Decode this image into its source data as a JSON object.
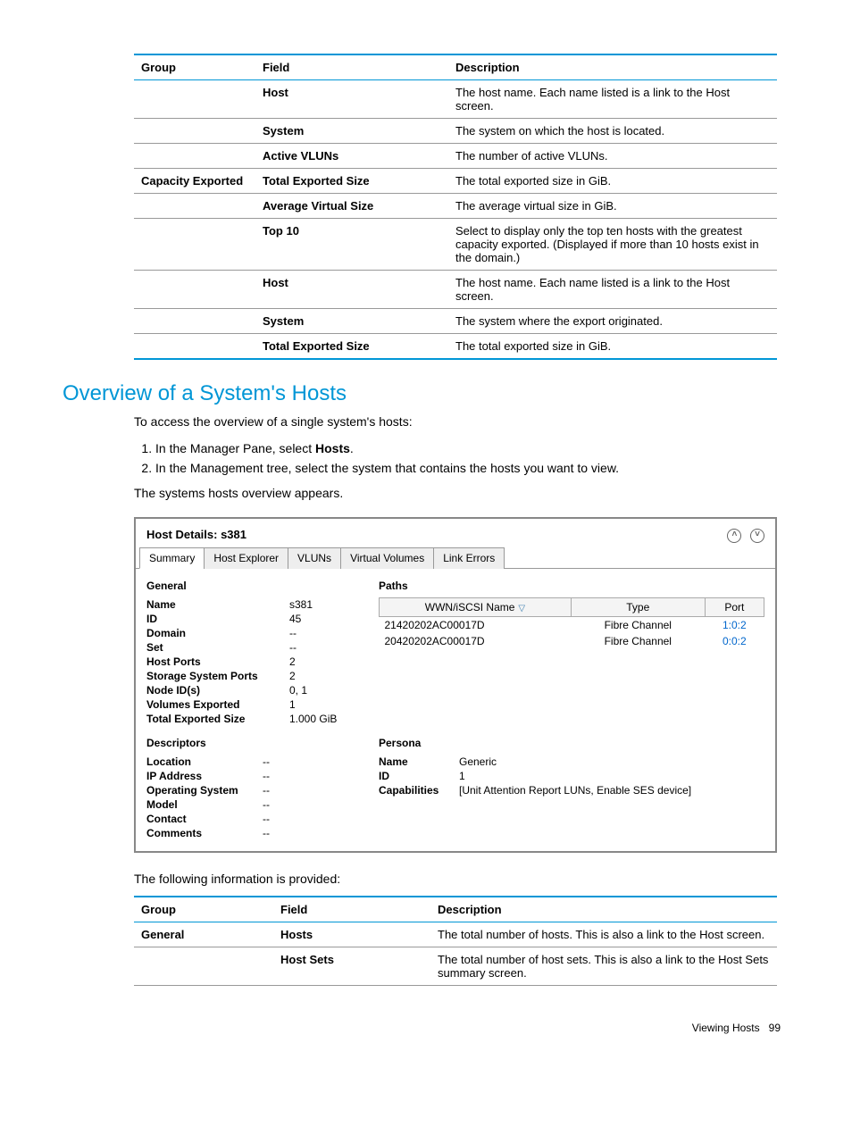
{
  "table1": {
    "headers": [
      "Group",
      "Field",
      "Description"
    ],
    "rows": [
      {
        "group": "",
        "field": "Host",
        "desc": "The host name. Each name listed is a link to the Host screen."
      },
      {
        "group": "",
        "field": "System",
        "desc": "The system on which the host is located."
      },
      {
        "group": "",
        "field": "Active VLUNs",
        "desc": "The number of active VLUNs."
      },
      {
        "group": "Capacity Exported",
        "field": "Total Exported Size",
        "desc": "The total exported size in GiB."
      },
      {
        "group": "",
        "field": "Average Virtual Size",
        "desc": "The average virtual size in GiB."
      },
      {
        "group": "",
        "field": "Top 10",
        "desc": "Select to display only the top ten hosts with the greatest capacity exported. (Displayed if more than 10 hosts exist in the domain.)"
      },
      {
        "group": "",
        "field": "Host",
        "desc": "The host name. Each name listed is a link to the Host screen."
      },
      {
        "group": "",
        "field": "System",
        "desc": "The system where the export originated."
      },
      {
        "group": "",
        "field": "Total Exported Size",
        "desc": "The total exported size in GiB."
      }
    ]
  },
  "heading": "Overview of a System's Hosts",
  "intro": "To access the overview of a single system's hosts:",
  "steps": {
    "s1_pre": "In the Manager Pane, select ",
    "s1_bold": "Hosts",
    "s1_post": ".",
    "s2": "In the Management tree, select the system that contains the hosts you want to view."
  },
  "overview_line": "The systems hosts overview appears.",
  "ui": {
    "title": "Host Details: s381",
    "tabs": [
      "Summary",
      "Host Explorer",
      "VLUNs",
      "Virtual Volumes",
      "Link Errors"
    ],
    "general_head": "General",
    "general": [
      {
        "label": "Name",
        "val": "s381"
      },
      {
        "label": "ID",
        "val": "45"
      },
      {
        "label": "Domain",
        "val": "--"
      },
      {
        "label": "Set",
        "val": "--"
      },
      {
        "label": "Host Ports",
        "val": "2"
      },
      {
        "label": "Storage System Ports",
        "val": "2"
      },
      {
        "label": "Node ID(s)",
        "val": "0, 1"
      },
      {
        "label": "Volumes Exported",
        "val": "1"
      },
      {
        "label": "Total Exported Size",
        "val": "1.000 GiB"
      }
    ],
    "paths_head": "Paths",
    "paths_cols": [
      "WWN/iSCSI Name",
      "Type",
      "Port"
    ],
    "paths_rows": [
      {
        "name": "21420202AC00017D",
        "type": "Fibre Channel",
        "port": "1:0:2"
      },
      {
        "name": "20420202AC00017D",
        "type": "Fibre Channel",
        "port": "0:0:2"
      }
    ],
    "descriptors_head": "Descriptors",
    "descriptors": [
      {
        "label": "Location",
        "val": "--"
      },
      {
        "label": "IP Address",
        "val": "--"
      },
      {
        "label": "Operating System",
        "val": "--"
      },
      {
        "label": "Model",
        "val": "--"
      },
      {
        "label": "Contact",
        "val": "--"
      },
      {
        "label": "Comments",
        "val": "--"
      }
    ],
    "persona_head": "Persona",
    "persona": [
      {
        "label": "Name",
        "val": "Generic"
      },
      {
        "label": "ID",
        "val": "1"
      },
      {
        "label": "Capabilities",
        "val": "[Unit Attention Report LUNs, Enable SES device]"
      }
    ]
  },
  "following_line": "The following information is provided:",
  "table2": {
    "headers": [
      "Group",
      "Field",
      "Description"
    ],
    "rows": [
      {
        "group": "General",
        "field": "Hosts",
        "desc": "The total number of hosts. This is also a link to the Host screen."
      },
      {
        "group": "",
        "field": "Host Sets",
        "desc": "The total number of host sets. This is also a link to the Host Sets summary screen."
      }
    ]
  },
  "footer_label": "Viewing Hosts",
  "footer_page": "99"
}
